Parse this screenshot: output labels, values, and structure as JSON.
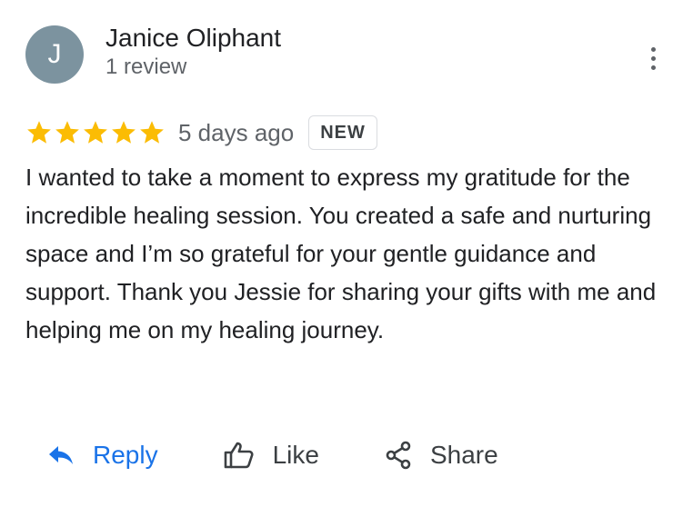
{
  "reviewer": {
    "avatar_initial": "J",
    "name": "Janice Oliphant",
    "review_count": "1 review"
  },
  "review": {
    "rating": 5,
    "max_rating": 5,
    "date": "5 days ago",
    "badge": "NEW",
    "text": "I wanted to take a moment to express my gratitude for the incredible healing session. You created a safe and nurturing space and I’m so grateful for your gentle guidance and support. Thank you Jessie for sharing your gifts with me and helping me on my healing journey."
  },
  "actions": {
    "reply_label": "Reply",
    "like_label": "Like",
    "share_label": "Share"
  },
  "icons": {
    "more": "more-vert-icon",
    "star": "star-icon",
    "reply": "reply-arrow-icon",
    "like": "thumbs-up-icon",
    "share": "share-icon"
  },
  "colors": {
    "avatar_bg": "#7c939f",
    "star": "#fbbc04",
    "accent": "#1a73e8",
    "secondary_text": "#5f6368"
  }
}
